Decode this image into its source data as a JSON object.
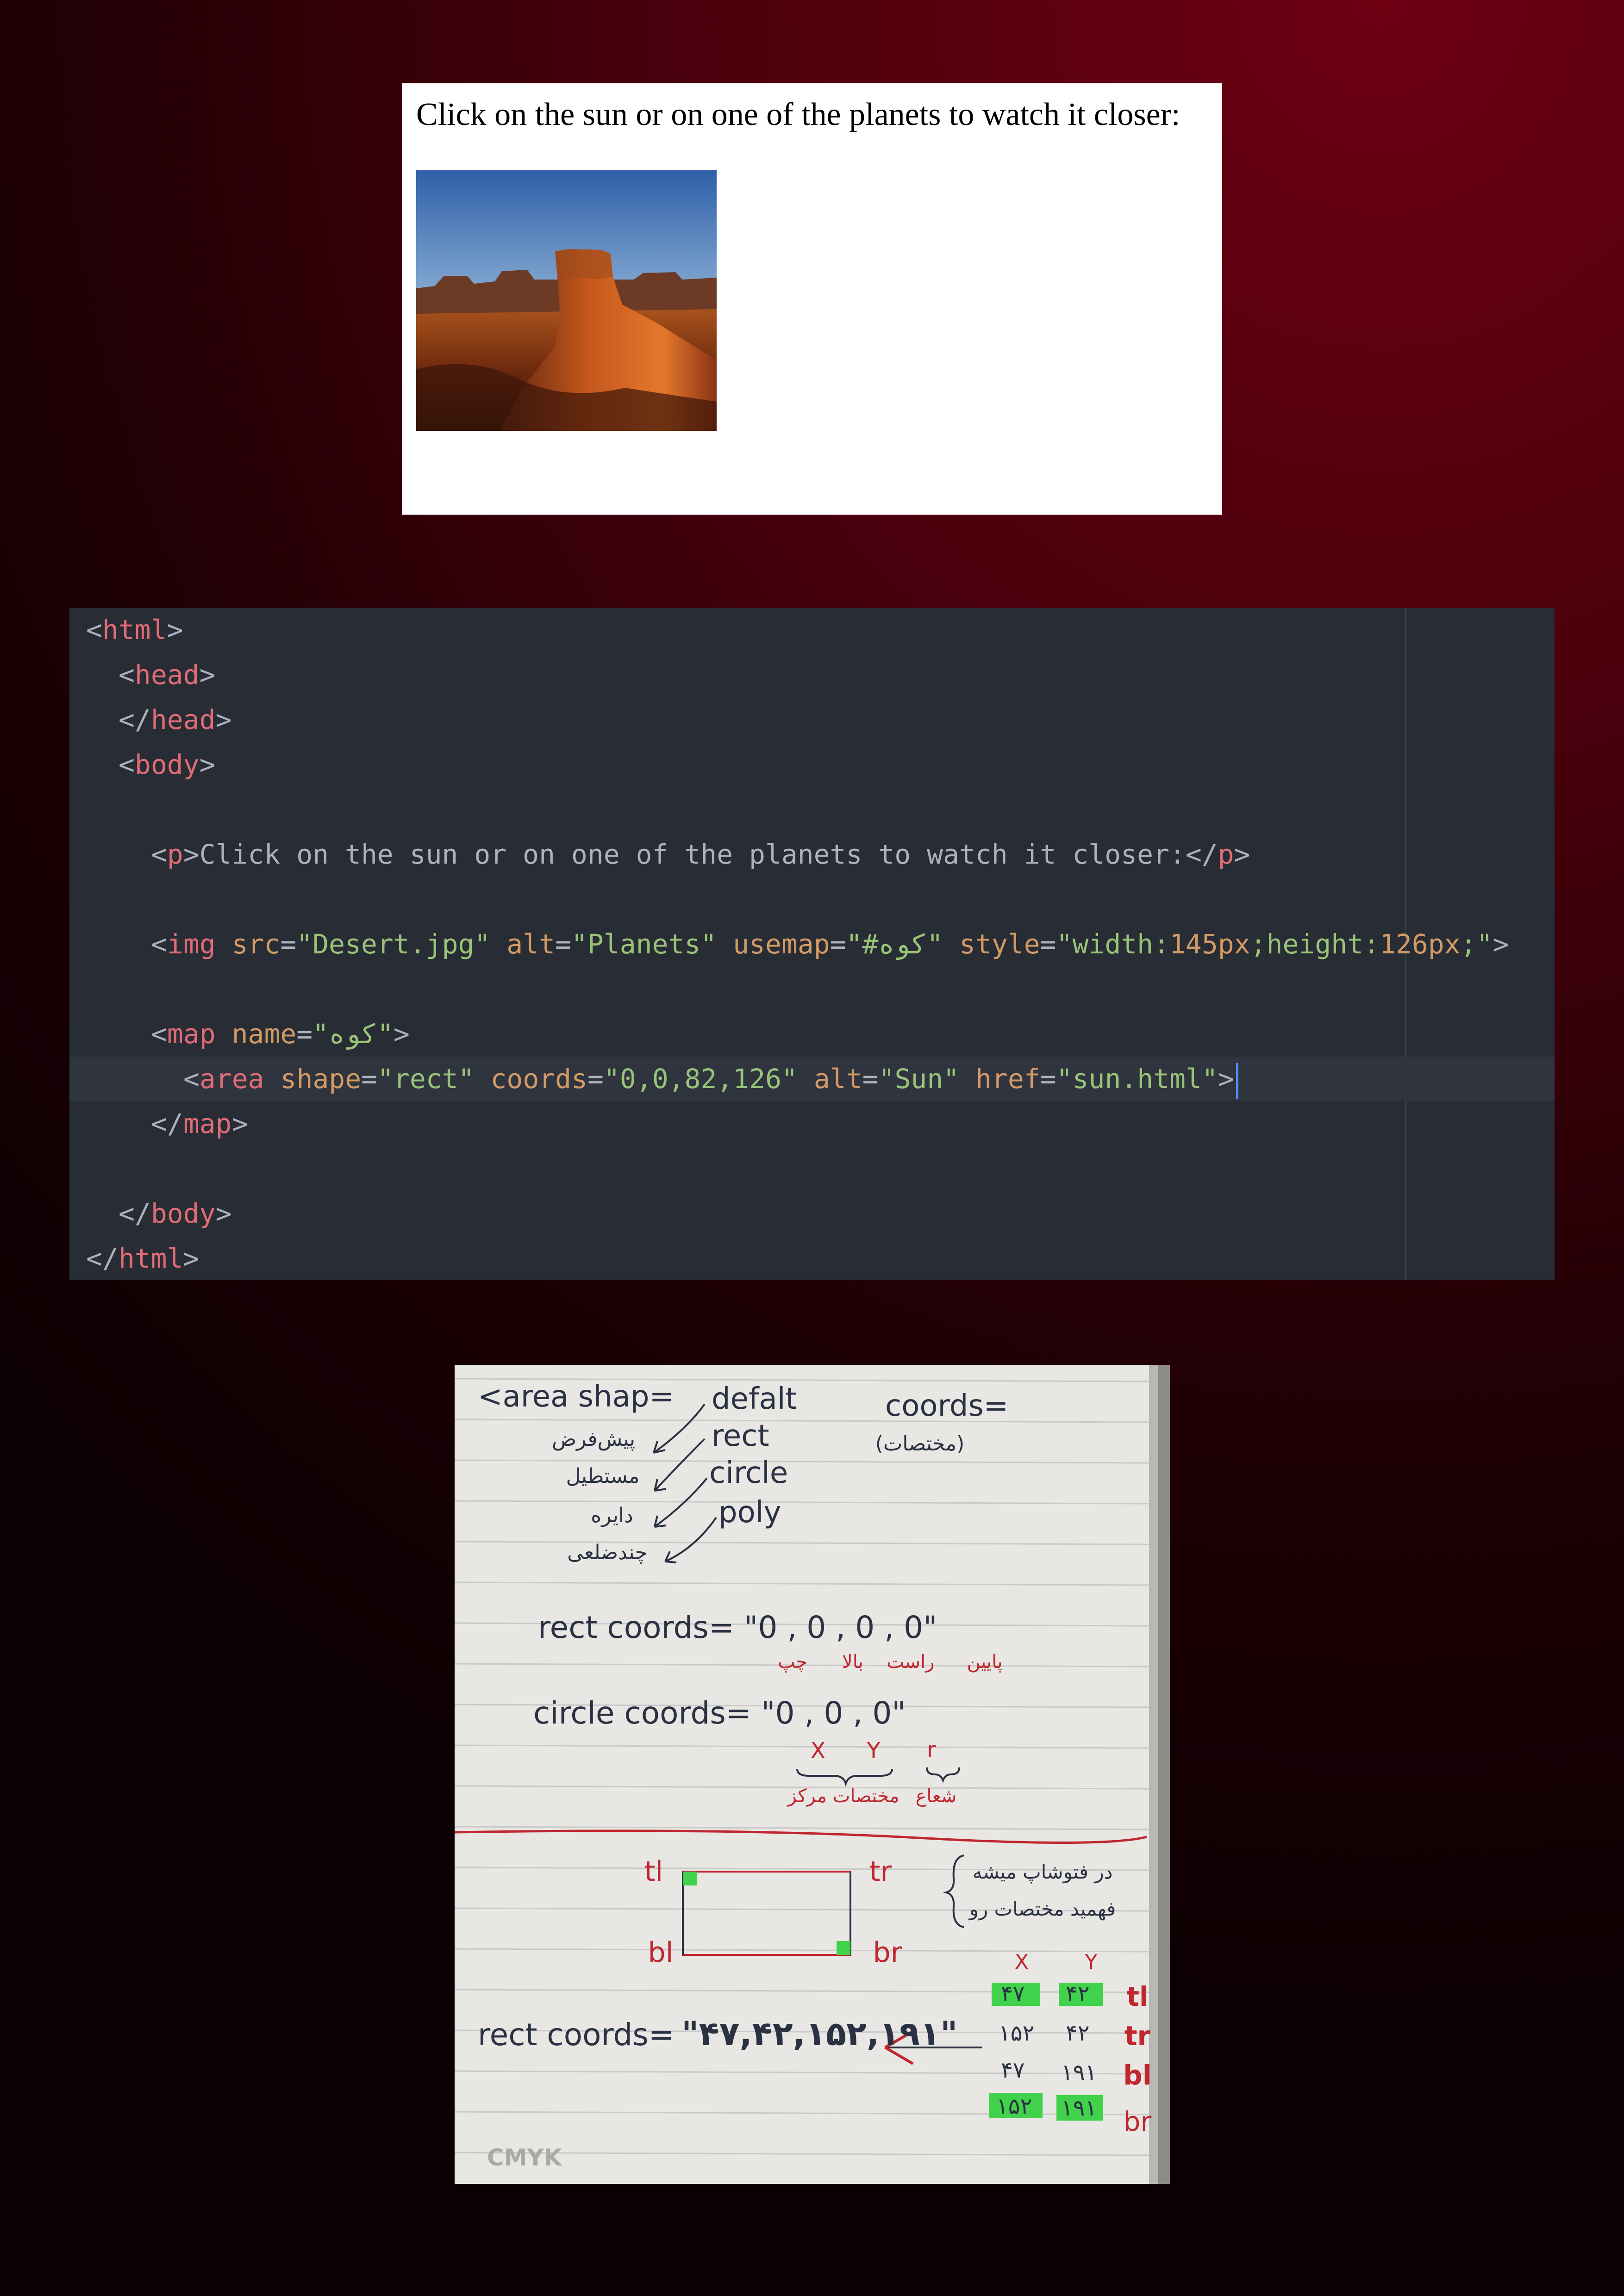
{
  "preview": {
    "text": "Click on the sun or on one of the planets to watch it closer:",
    "image_alt": "Planets"
  },
  "editor": {
    "lines": [
      {
        "indent": 0,
        "parts": [
          [
            "p",
            "<"
          ],
          [
            "tag",
            "html"
          ],
          [
            "p",
            ">"
          ]
        ]
      },
      {
        "indent": 2,
        "parts": [
          [
            "p",
            "<"
          ],
          [
            "tag",
            "head"
          ],
          [
            "p",
            ">"
          ]
        ]
      },
      {
        "indent": 2,
        "parts": [
          [
            "p",
            "</"
          ],
          [
            "tag",
            "head"
          ],
          [
            "p",
            ">"
          ]
        ]
      },
      {
        "indent": 2,
        "parts": [
          [
            "p",
            "<"
          ],
          [
            "tag",
            "body"
          ],
          [
            "p",
            ">"
          ]
        ]
      },
      {
        "indent": 0,
        "parts": []
      },
      {
        "indent": 4,
        "parts": [
          [
            "p",
            "<"
          ],
          [
            "tag",
            "p"
          ],
          [
            "p",
            ">"
          ],
          [
            "text",
            "Click on the sun or on one of the planets to watch it closer:"
          ],
          [
            "p",
            "</"
          ],
          [
            "tag",
            "p"
          ],
          [
            "p",
            ">"
          ]
        ]
      },
      {
        "indent": 0,
        "parts": []
      },
      {
        "indent": 4,
        "parts": [
          [
            "p",
            "<"
          ],
          [
            "tag",
            "img "
          ],
          [
            "attr",
            "src"
          ],
          [
            "p",
            "="
          ],
          [
            "str",
            "\"Desert.jpg\" "
          ],
          [
            "attr",
            "alt"
          ],
          [
            "p",
            "="
          ],
          [
            "str",
            "\"Planets\" "
          ],
          [
            "attr",
            "usemap"
          ],
          [
            "p",
            "="
          ],
          [
            "str",
            "\"#کوه\" "
          ],
          [
            "attr",
            "style"
          ],
          [
            "p",
            "="
          ],
          [
            "str",
            "\"width:"
          ],
          [
            "attr",
            "145px"
          ],
          [
            "str",
            ";height:"
          ],
          [
            "attr",
            "126px"
          ],
          [
            "str",
            ";\""
          ],
          [
            "p",
            ">"
          ]
        ]
      },
      {
        "indent": 0,
        "parts": []
      },
      {
        "indent": 4,
        "parts": [
          [
            "p",
            "<"
          ],
          [
            "tag",
            "map "
          ],
          [
            "attr",
            "name"
          ],
          [
            "p",
            "="
          ],
          [
            "str",
            "\"کوه\""
          ],
          [
            "p",
            ">"
          ]
        ]
      },
      {
        "indent": 6,
        "active": true,
        "parts": [
          [
            "p",
            "<"
          ],
          [
            "tag",
            "area "
          ],
          [
            "attr",
            "shape"
          ],
          [
            "p",
            "="
          ],
          [
            "str",
            "\"rect\" "
          ],
          [
            "attr",
            "coords"
          ],
          [
            "p",
            "="
          ],
          [
            "str",
            "\"0,0,82,126\" "
          ],
          [
            "attr",
            "alt"
          ],
          [
            "p",
            "="
          ],
          [
            "str",
            "\"Sun\" "
          ],
          [
            "attr",
            "href"
          ],
          [
            "p",
            "="
          ],
          [
            "str",
            "\"sun.html\""
          ],
          [
            "p",
            ">"
          ]
        ]
      },
      {
        "indent": 4,
        "parts": [
          [
            "p",
            "</"
          ],
          [
            "tag",
            "map"
          ],
          [
            "p",
            ">"
          ]
        ]
      },
      {
        "indent": 0,
        "parts": []
      },
      {
        "indent": 2,
        "parts": [
          [
            "p",
            "</"
          ],
          [
            "tag",
            "body"
          ],
          [
            "p",
            ">"
          ]
        ]
      },
      {
        "indent": 0,
        "parts": [
          [
            "p",
            "</"
          ],
          [
            "tag",
            "html"
          ],
          [
            "p",
            ">"
          ]
        ]
      }
    ]
  },
  "notebook": {
    "area_shape": "<area shap=",
    "shape_values": [
      "defalt",
      "rect",
      "circle",
      "poly"
    ],
    "shape_values_fa": [
      "پیش‌فرض",
      "مستطیل",
      "دایره",
      "چندضلعی"
    ],
    "coords_label": "coords=",
    "coords_fa": "(مختصات)",
    "rect_line": "rect  coords= \"0 , 0 , 0 , 0\"",
    "rect_fa": [
      "چپ",
      "بالا",
      "راست",
      "پایین"
    ],
    "circle_line": "circle  coords= \"0 , 0 , 0\"",
    "circle_vars": [
      "X",
      "Y",
      "r"
    ],
    "circle_fa": [
      "مختصات مرکز",
      "شعاع"
    ],
    "corners": [
      "tl",
      "tr",
      "bl",
      "br"
    ],
    "note_fa": [
      "در فتوشاپ میشه",
      "فهمید مختصات رو"
    ],
    "table_head": [
      "X",
      "Y"
    ],
    "table_rows": [
      {
        "x": "۴۷",
        "y": "۴۲",
        "corner": "tl",
        "hl": true
      },
      {
        "x": "۱۵۲",
        "y": "۴۲",
        "corner": "tr",
        "hl": false
      },
      {
        "x": "۴۷",
        "y": "۱۹۱",
        "corner": "bl",
        "hl": false
      },
      {
        "x": "۱۵۲",
        "y": "۱۹۱",
        "corner": "br",
        "hl": true
      }
    ],
    "final_label": "rect coords=",
    "final_value": "\"۴۷,۴۲,۱۵۲,۱۹۱\"",
    "watermark": "CMYK"
  },
  "colors": {
    "ink_blue": "#2a3142",
    "ink_red": "#c0262e",
    "highlight": "#3fd24a"
  }
}
